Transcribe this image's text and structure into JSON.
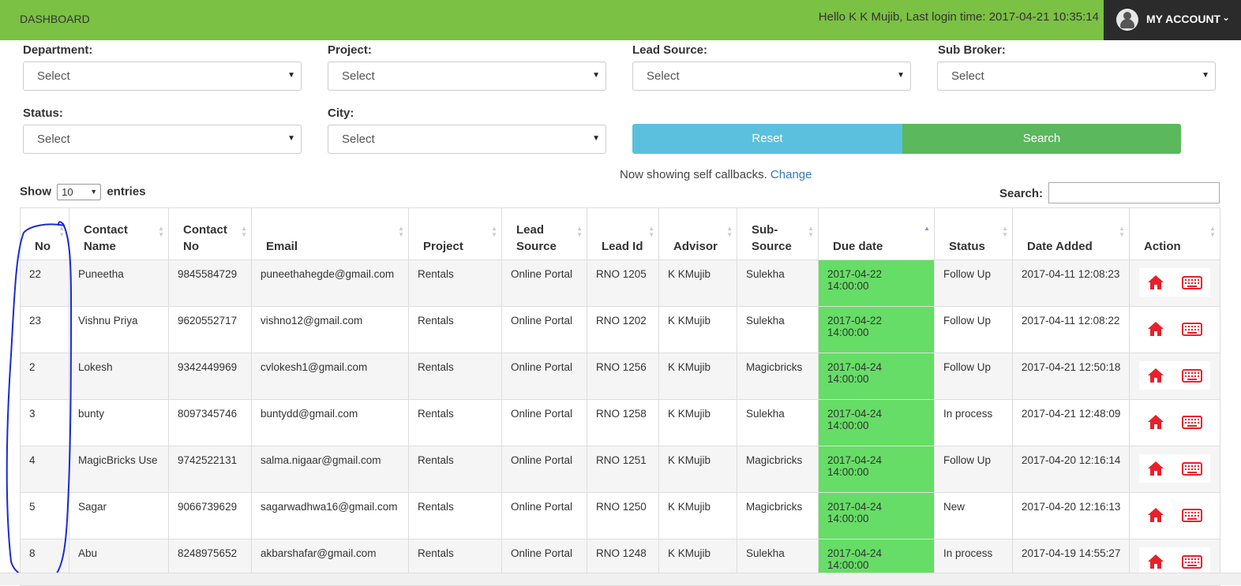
{
  "topbar": {
    "brand": "DASHBOARD",
    "greeting": "Hello K K Mujib, Last login time: 2017-04-21 10:35:14",
    "account_label": "MY ACCOUNT",
    "account_chevron": "⌄"
  },
  "filters": {
    "department_label": "Department:",
    "department_value": "Select",
    "project_label": "Project:",
    "project_value": "Select",
    "lead_source_label": "Lead Source:",
    "lead_source_value": "Select",
    "sub_broker_label": "Sub Broker:",
    "sub_broker_value": "Select",
    "status_label": "Status:",
    "status_value": "Select",
    "city_label": "City:",
    "city_value": "Select",
    "reset_label": "Reset",
    "search_label": "Search"
  },
  "notice": {
    "text": "Now showing self callbacks. ",
    "link": "Change"
  },
  "entries": {
    "show": "Show",
    "value": "10",
    "suffix": "entries"
  },
  "search": {
    "label": "Search:",
    "value": ""
  },
  "table": {
    "headers": {
      "no": "No",
      "contact_name": "Contact Name",
      "contact_no": "Contact No",
      "email": "Email",
      "project": "Project",
      "lead_source": "Lead Source",
      "lead_id": "Lead Id",
      "advisor": "Advisor",
      "sub_source": "Sub-Source",
      "due_date": "Due date",
      "status": "Status",
      "date_added": "Date Added",
      "action": "Action"
    },
    "rows": [
      {
        "no": "22",
        "name": "Puneetha",
        "phone": "9845584729",
        "email": "puneethahegde@gmail.com",
        "project": "Rentals",
        "source": "Online Portal",
        "lead_id": "RNO 1205",
        "advisor": "K KMujib",
        "sub_source": "Sulekha",
        "due": "2017-04-22 14:00:00",
        "status": "Follow Up",
        "added": "2017-04-11 12:08:23"
      },
      {
        "no": "23",
        "name": "Vishnu Priya",
        "phone": "9620552717",
        "email": "vishno12@gmail.com",
        "project": "Rentals",
        "source": "Online Portal",
        "lead_id": "RNO 1202",
        "advisor": "K KMujib",
        "sub_source": "Sulekha",
        "due": "2017-04-22 14:00:00",
        "status": "Follow Up",
        "added": "2017-04-11 12:08:22"
      },
      {
        "no": "2",
        "name": "Lokesh",
        "phone": "9342449969",
        "email": "cvlokesh1@gmail.com",
        "project": "Rentals",
        "source": "Online Portal",
        "lead_id": "RNO 1256",
        "advisor": "K KMujib",
        "sub_source": "Magicbricks",
        "due": "2017-04-24 14:00:00",
        "status": "Follow Up",
        "added": "2017-04-21 12:50:18"
      },
      {
        "no": "3",
        "name": "bunty",
        "phone": "8097345746",
        "email": "buntydd@gmail.com",
        "project": "Rentals",
        "source": "Online Portal",
        "lead_id": "RNO 1258",
        "advisor": "K KMujib",
        "sub_source": "Sulekha",
        "due": "2017-04-24 14:00:00",
        "status": "In process",
        "added": "2017-04-21 12:48:09"
      },
      {
        "no": "4",
        "name": "MagicBricks Use",
        "phone": "9742522131",
        "email": "salma.nigaar@gmail.com",
        "project": "Rentals",
        "source": "Online Portal",
        "lead_id": "RNO 1251",
        "advisor": "K KMujib",
        "sub_source": "Magicbricks",
        "due": "2017-04-24 14:00:00",
        "status": "Follow Up",
        "added": "2017-04-20 12:16:14"
      },
      {
        "no": "5",
        "name": "Sagar",
        "phone": "9066739629",
        "email": "sagarwadhwa16@gmail.com",
        "project": "Rentals",
        "source": "Online Portal",
        "lead_id": "RNO 1250",
        "advisor": "K KMujib",
        "sub_source": "Magicbricks",
        "due": "2017-04-24 14:00:00",
        "status": "New",
        "added": "2017-04-20 12:16:13"
      },
      {
        "no": "8",
        "name": "Abu",
        "phone": "8248975652",
        "email": "akbarshafar@gmail.com",
        "project": "Rentals",
        "source": "Online Portal",
        "lead_id": "RNO 1248",
        "advisor": "K KMujib",
        "sub_source": "Sulekha",
        "due": "2017-04-24 14:00:00",
        "status": "In process",
        "added": "2017-04-19 14:55:27"
      }
    ]
  },
  "colors": {
    "topbar": "#7bc143",
    "account_bg": "#2b2b2b",
    "reset": "#5bc0de",
    "search": "#5cb85c",
    "due_highlight": "#66dd66",
    "action_icon": "#e8202a",
    "annotation": "#1a2ad1"
  },
  "icons": {
    "home": "home-icon",
    "keyboard": "keyboard-icon",
    "avatar": "avatar-icon"
  }
}
